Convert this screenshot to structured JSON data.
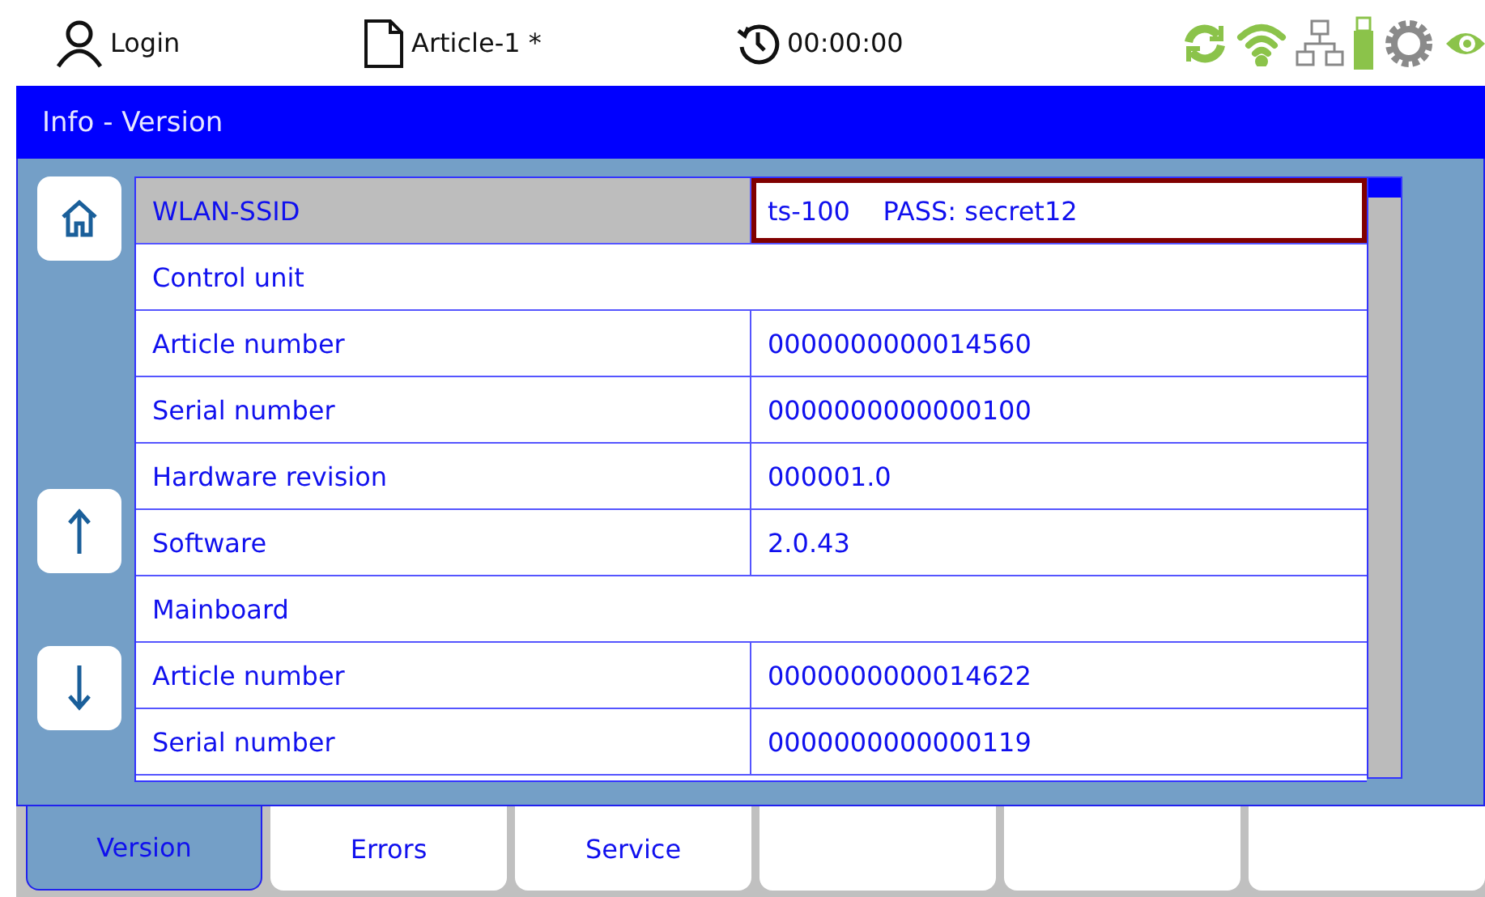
{
  "header": {
    "user": "Login",
    "article": "Article-1 *",
    "timer": "00:00:00"
  },
  "title": "Info - Version",
  "table": {
    "rows": [
      {
        "kind": "pair",
        "label": "WLAN-SSID",
        "value": "ts-100    PASS: secret12",
        "selected": true
      },
      {
        "kind": "section",
        "label": "Control unit",
        "selected": false
      },
      {
        "kind": "pair",
        "label": "Article number",
        "value": "0000000000014560",
        "selected": false
      },
      {
        "kind": "pair",
        "label": "Serial number",
        "value": "0000000000000100",
        "selected": false
      },
      {
        "kind": "pair",
        "label": "Hardware revision",
        "value": "000001.0",
        "selected": false
      },
      {
        "kind": "pair",
        "label": "Software",
        "value": "2.0.43",
        "selected": false
      },
      {
        "kind": "section",
        "label": "Mainboard",
        "selected": false
      },
      {
        "kind": "pair",
        "label": "Article number",
        "value": "0000000000014622",
        "selected": false
      },
      {
        "kind": "pair",
        "label": "Serial number",
        "value": "0000000000000119",
        "selected": false
      }
    ]
  },
  "tabs": [
    {
      "label": "Version",
      "selected": true
    },
    {
      "label": "Errors",
      "selected": false
    },
    {
      "label": "Service",
      "selected": false
    },
    {
      "selected": false
    },
    {
      "selected": false
    },
    {
      "selected": false
    }
  ]
}
